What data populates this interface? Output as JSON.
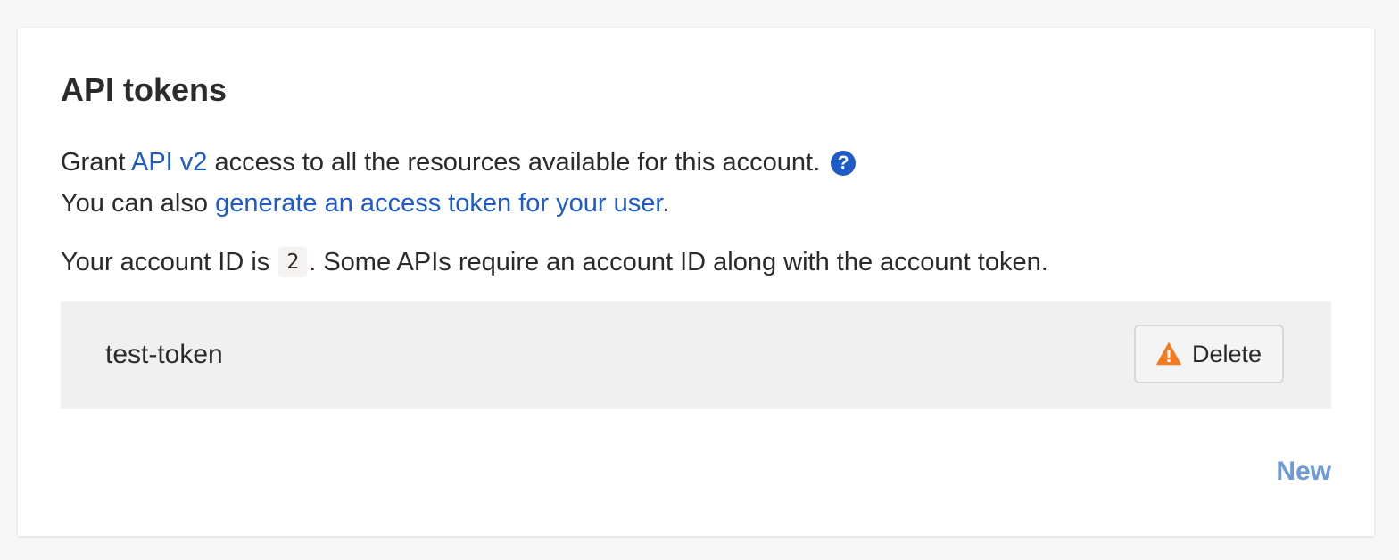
{
  "card": {
    "title": "API tokens",
    "intro": {
      "grant_prefix": "Grant ",
      "api_link": "API v2",
      "grant_suffix": " access to all the resources available for this account.",
      "help_icon": "question-circle-icon",
      "also_prefix": "You can also ",
      "user_token_link": "generate an access token for your user",
      "also_suffix": "."
    },
    "account": {
      "prefix": "Your account ID is ",
      "id": "2",
      "suffix": ". Some APIs require an account ID along with the account token."
    },
    "tokens": [
      {
        "name": "test-token",
        "delete_label": "Delete",
        "delete_icon": "warning-triangle-icon"
      }
    ],
    "new_label": "New"
  },
  "colors": {
    "link": "#1e5bc6",
    "new_link": "#6d9ad9",
    "warning": "#f47a20",
    "row_background": "#f0f0f0"
  }
}
